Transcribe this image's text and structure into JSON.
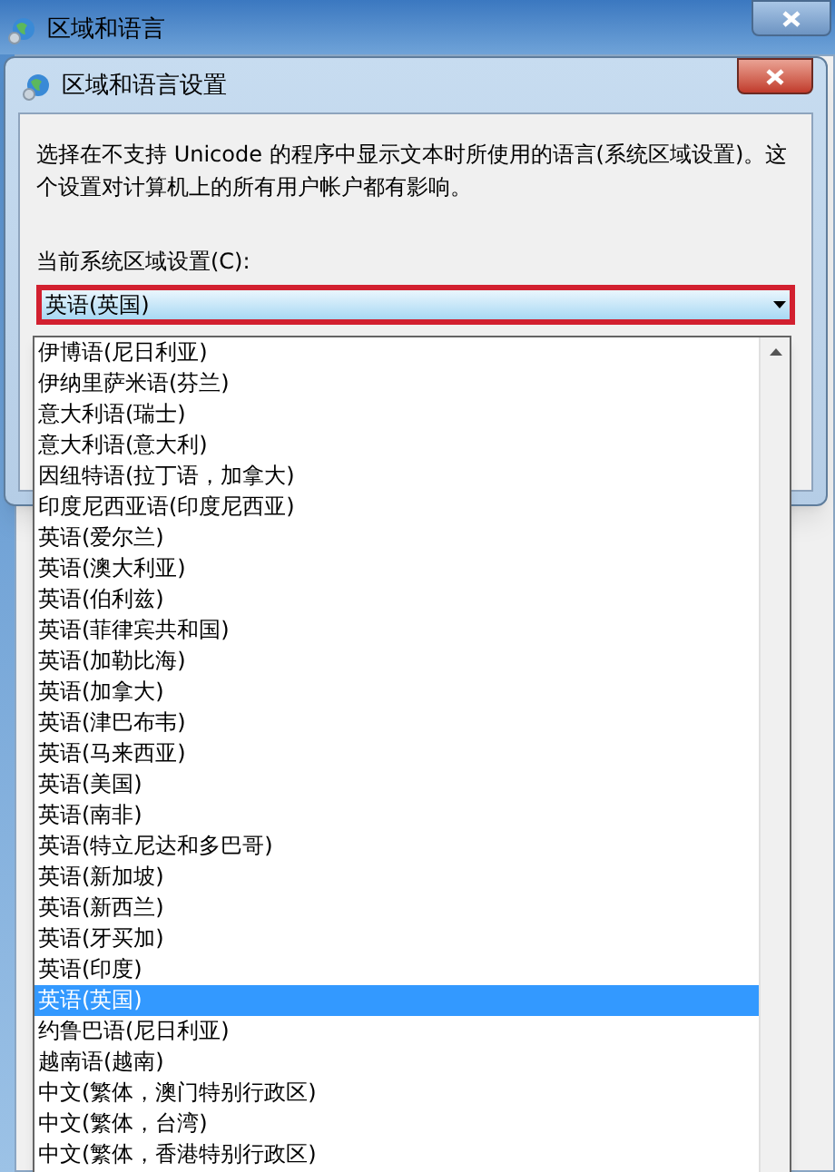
{
  "window": {
    "title": "区域和语言"
  },
  "dialog": {
    "title": "区域和语言设置",
    "description": "选择在不支持 Unicode 的程序中显示文本时所使用的语言(系统区域设置)。这个设置对计算机上的所有用户帐户都有影响。",
    "locale_label": "当前系统区域设置(C):",
    "locale_value": "英语(英国)",
    "expanded": true
  },
  "options": [
    {
      "label": "伊博语(尼日利亚)",
      "selected": false
    },
    {
      "label": "伊纳里萨米语(芬兰)",
      "selected": false
    },
    {
      "label": "意大利语(瑞士)",
      "selected": false
    },
    {
      "label": "意大利语(意大利)",
      "selected": false
    },
    {
      "label": "因纽特语(拉丁语，加拿大)",
      "selected": false
    },
    {
      "label": "印度尼西亚语(印度尼西亚)",
      "selected": false
    },
    {
      "label": "英语(爱尔兰)",
      "selected": false
    },
    {
      "label": "英语(澳大利亚)",
      "selected": false
    },
    {
      "label": "英语(伯利兹)",
      "selected": false
    },
    {
      "label": "英语(菲律宾共和国)",
      "selected": false
    },
    {
      "label": "英语(加勒比海)",
      "selected": false
    },
    {
      "label": "英语(加拿大)",
      "selected": false
    },
    {
      "label": "英语(津巴布韦)",
      "selected": false
    },
    {
      "label": "英语(马来西亚)",
      "selected": false
    },
    {
      "label": "英语(美国)",
      "selected": false
    },
    {
      "label": "英语(南非)",
      "selected": false
    },
    {
      "label": "英语(特立尼达和多巴哥)",
      "selected": false
    },
    {
      "label": "英语(新加坡)",
      "selected": false
    },
    {
      "label": "英语(新西兰)",
      "selected": false
    },
    {
      "label": "英语(牙买加)",
      "selected": false
    },
    {
      "label": "英语(印度)",
      "selected": false
    },
    {
      "label": "英语(英国)",
      "selected": true
    },
    {
      "label": "约鲁巴语(尼日利亚)",
      "selected": false
    },
    {
      "label": "越南语(越南)",
      "selected": false
    },
    {
      "label": "中文(繁体，澳门特别行政区)",
      "selected": false
    },
    {
      "label": "中文(繁体，台湾)",
      "selected": false
    },
    {
      "label": "中文(繁体，香港特别行政区)",
      "selected": false
    }
  ]
}
